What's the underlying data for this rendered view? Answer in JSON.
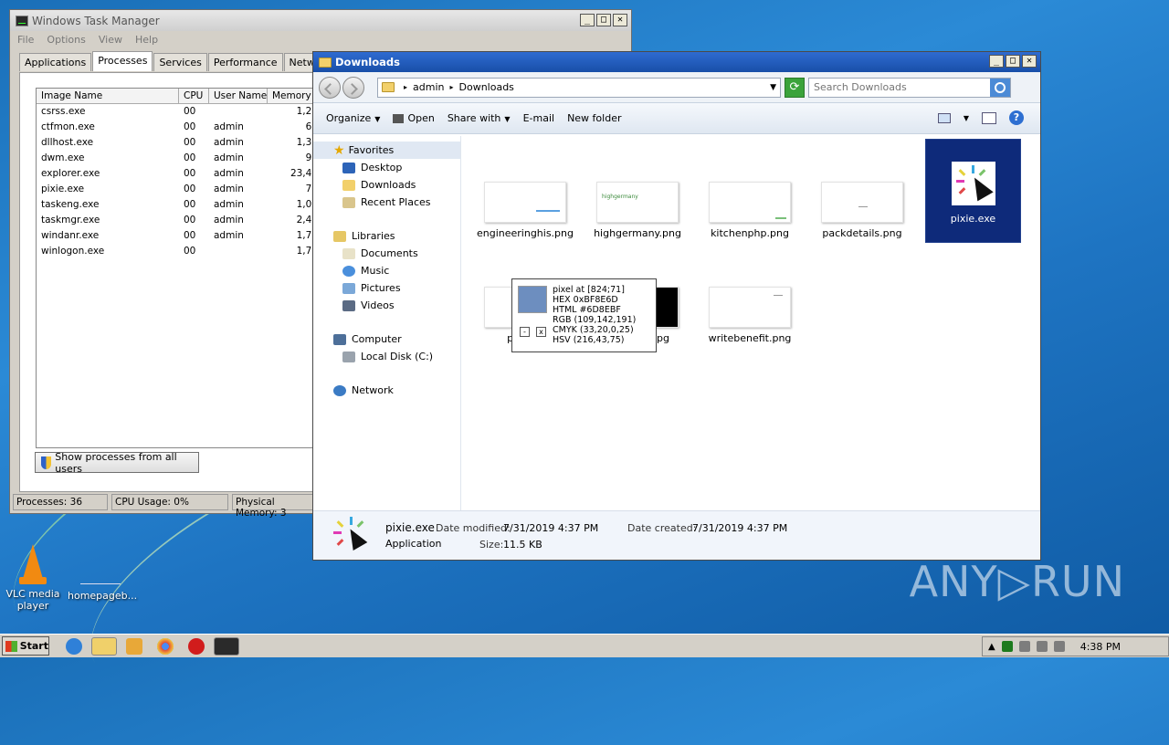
{
  "taskmgr": {
    "title": "Windows Task Manager",
    "menu": [
      "File",
      "Options",
      "View",
      "Help"
    ],
    "tabs": [
      "Applications",
      "Processes",
      "Services",
      "Performance",
      "Networking"
    ],
    "active_tab": "Processes",
    "columns": [
      "Image Name",
      "CPU",
      "User Name",
      "Memory ("
    ],
    "processes": [
      {
        "name": "csrss.exe",
        "cpu": "00",
        "user": "",
        "mem": "1,21"
      },
      {
        "name": "ctfmon.exe",
        "cpu": "00",
        "user": "admin",
        "mem": "69"
      },
      {
        "name": "dllhost.exe",
        "cpu": "00",
        "user": "admin",
        "mem": "1,32"
      },
      {
        "name": "dwm.exe",
        "cpu": "00",
        "user": "admin",
        "mem": "96"
      },
      {
        "name": "explorer.exe",
        "cpu": "00",
        "user": "admin",
        "mem": "23,42"
      },
      {
        "name": "pixie.exe",
        "cpu": "00",
        "user": "admin",
        "mem": "78"
      },
      {
        "name": "taskeng.exe",
        "cpu": "00",
        "user": "admin",
        "mem": "1,00"
      },
      {
        "name": "taskmgr.exe",
        "cpu": "00",
        "user": "admin",
        "mem": "2,49"
      },
      {
        "name": "windanr.exe",
        "cpu": "00",
        "user": "admin",
        "mem": "1,77"
      },
      {
        "name": "winlogon.exe",
        "cpu": "00",
        "user": "",
        "mem": "1,71"
      }
    ],
    "show_all_label": "Show processes from all users",
    "status": {
      "processes": "Processes: 36",
      "cpu": "CPU Usage: 0%",
      "memory": "Physical Memory: 3"
    }
  },
  "explorer": {
    "title": "Downloads",
    "breadcrumb": [
      "admin",
      "Downloads"
    ],
    "search_placeholder": "Search Downloads",
    "commands": [
      "Organize",
      "Open",
      "Share with",
      "E-mail",
      "New folder"
    ],
    "nav": {
      "favorites": "Favorites",
      "fav_items": [
        "Desktop",
        "Downloads",
        "Recent Places"
      ],
      "libraries": "Libraries",
      "lib_items": [
        "Documents",
        "Music",
        "Pictures",
        "Videos"
      ],
      "computer": "Computer",
      "computer_items": [
        "Local Disk (C:)"
      ],
      "network": "Network"
    },
    "files": [
      {
        "name": "engineeringhis.png"
      },
      {
        "name": "highgermany.png"
      },
      {
        "name": "kitchenphp.png"
      },
      {
        "name": "packdetails.png"
      },
      {
        "name": "pixie.exe"
      },
      {
        "name": "publica"
      },
      {
        "name": "pg"
      },
      {
        "name": "writebenefit.png"
      }
    ],
    "thumb_text": {
      "highgermany": "highgermany"
    },
    "details": {
      "name": "pixie.exe",
      "type": "Application",
      "modified_label": "Date modified:",
      "modified": "7/31/2019 4:37 PM",
      "created_label": "Date created:",
      "created": "7/31/2019 4:37 PM",
      "size_label": "Size:",
      "size": "11.5 KB"
    }
  },
  "pixel_tooltip": {
    "lines": [
      "pixel at [824;71]",
      "HEX 0xBF8E6D",
      "HTML #6D8EBF",
      "RGB (109,142,191)",
      "CMYK (33,20,0,25)",
      "HSV (216,43,75)"
    ],
    "swatch_color": "#6D8EBF",
    "min_btn": "-",
    "close_btn": "x"
  },
  "desktop": {
    "icons": [
      "VLC media player",
      "homepageb..."
    ],
    "watermark": "ANY▷RUN"
  },
  "taskbar": {
    "start": "Start",
    "clock": "4:38 PM"
  }
}
